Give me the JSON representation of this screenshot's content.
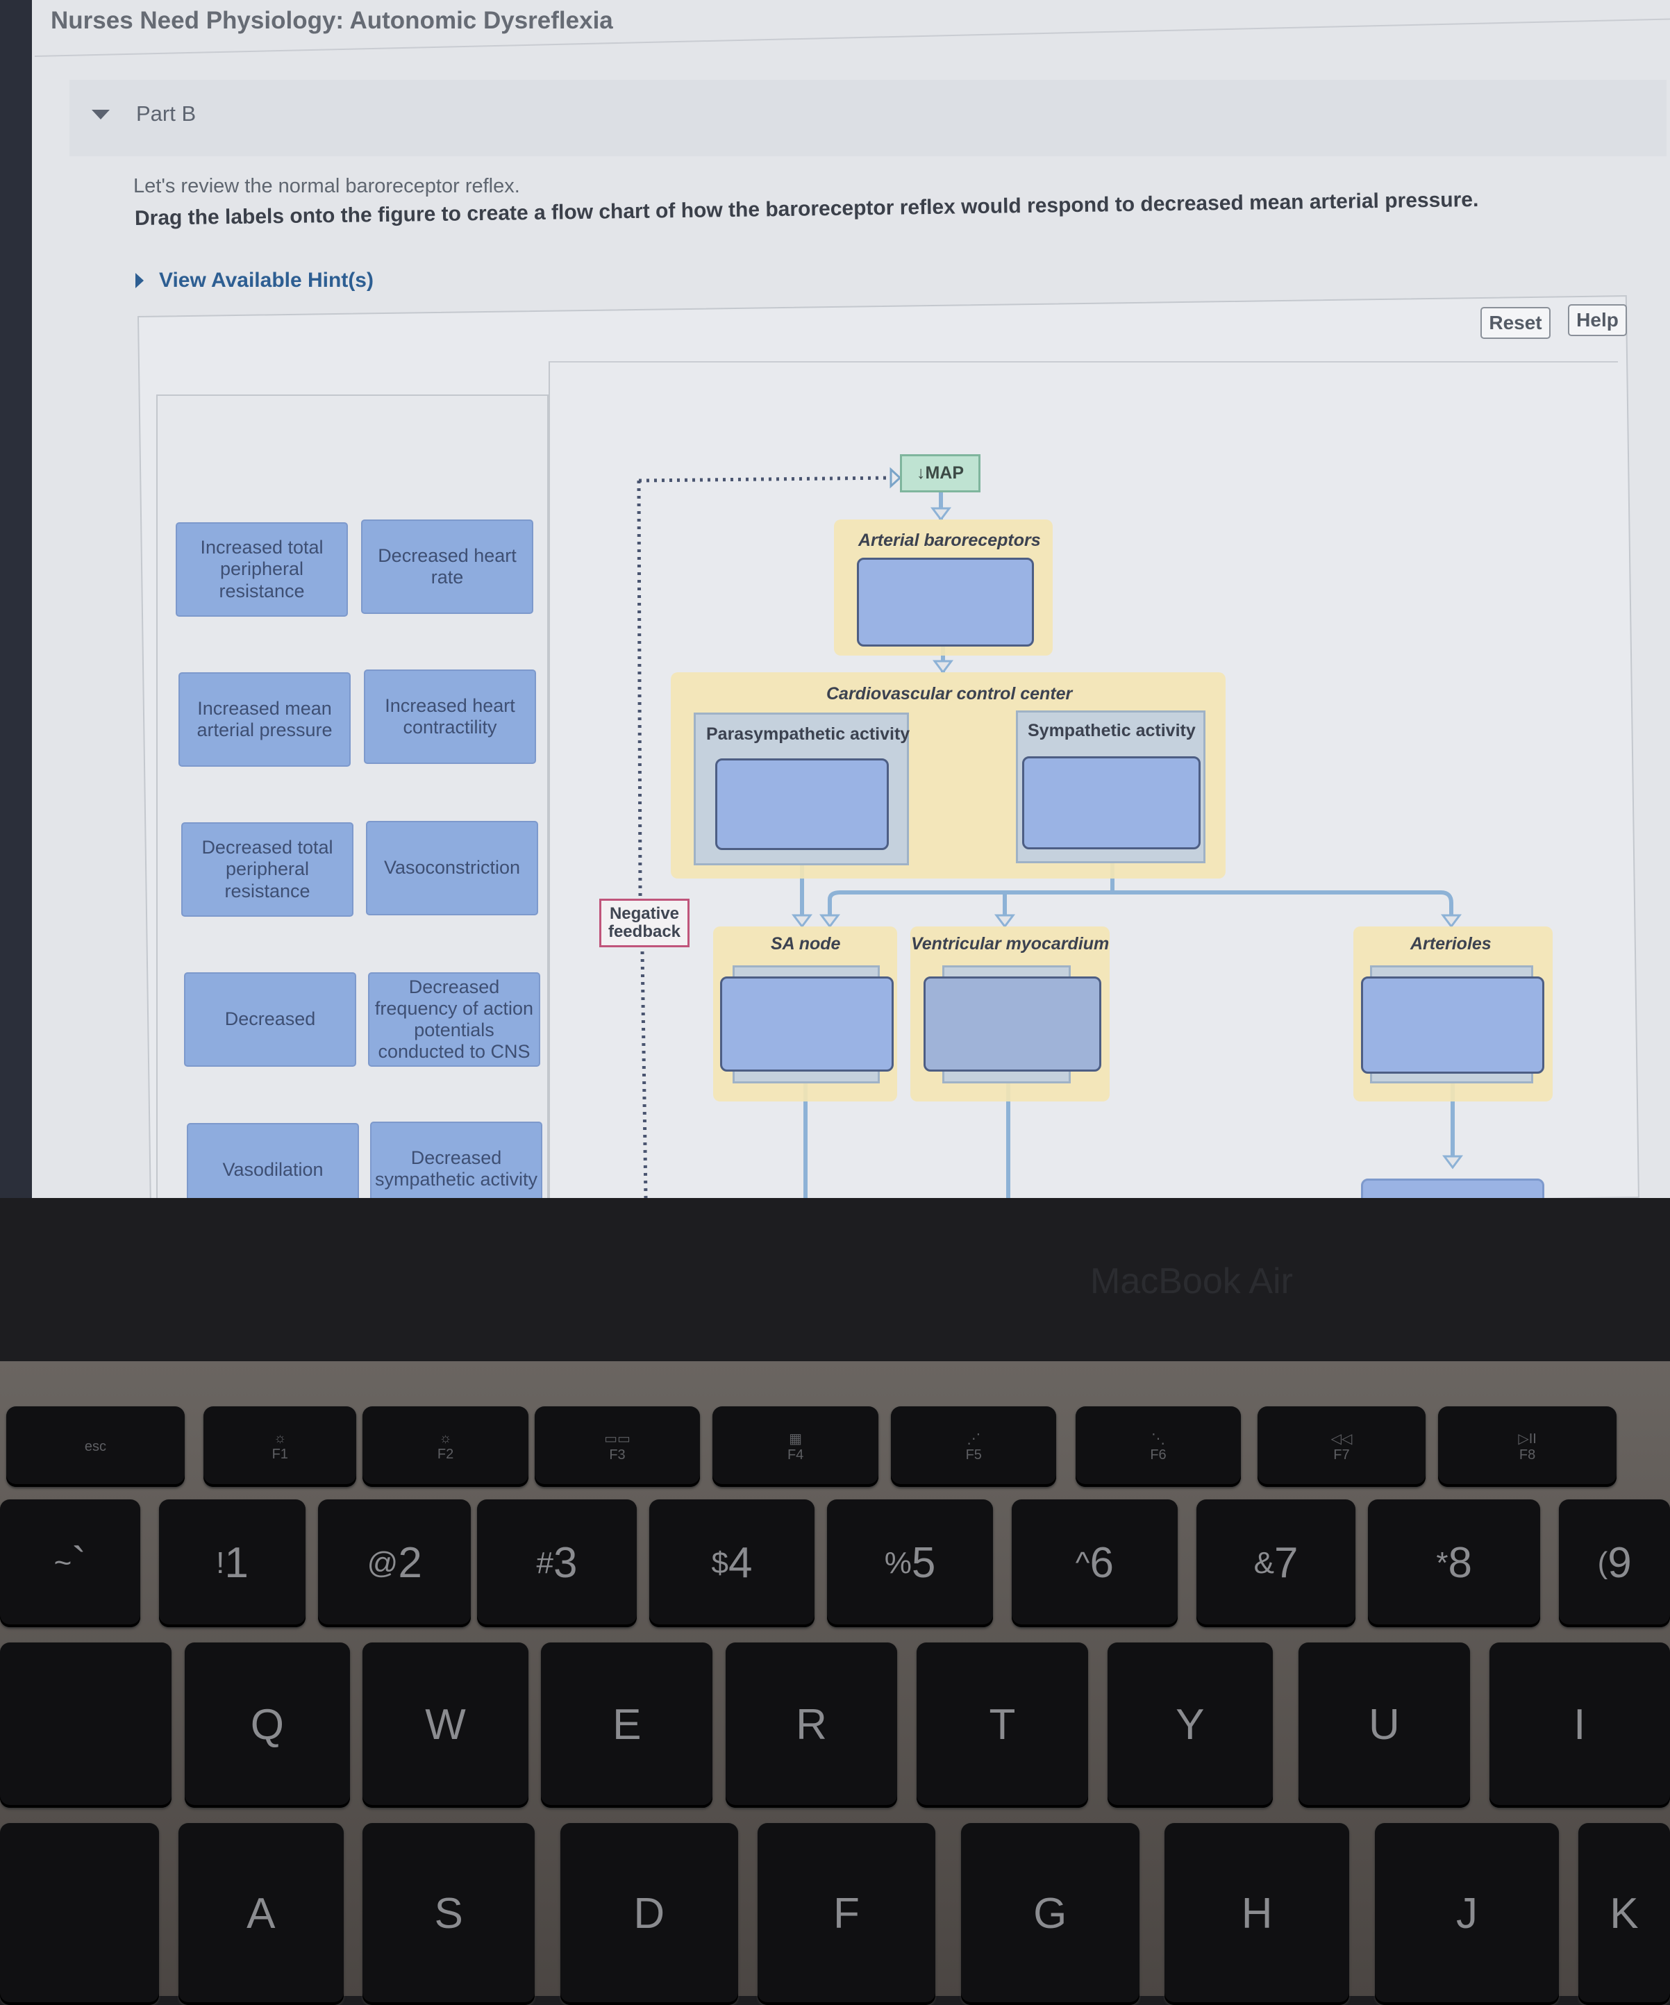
{
  "page": {
    "title": "Nurses Need Physiology: Autonomic Dysreflexia",
    "part": "Part B",
    "intro": "Let's review the normal baroreceptor reflex.",
    "instructions": "Drag the labels onto the figure to create a flow chart of how the baroreceptor reflex would respond to decreased mean arterial pressure.",
    "hint_link": "View Available Hint(s)"
  },
  "toolbar": {
    "reset": "Reset",
    "help": "Help"
  },
  "labels": [
    "Increased total peripheral resistance",
    "Decreased heart rate",
    "Increased mean arterial pressure",
    "Increased heart contractility",
    "Decreased total peripheral resistance",
    "Vasoconstriction",
    "Decreased",
    "Decreased frequency of action potentials conducted to CNS",
    "Vasodilation",
    "Decreased sympathetic activity"
  ],
  "diagram": {
    "map": "↓MAP",
    "arterial_baroreceptors": "Arterial baroreceptors",
    "control_center": "Cardiovascular control center",
    "parasympathetic": "Parasympathetic activity",
    "sympathetic": "Sympathetic activity",
    "sa_node": "SA node",
    "ventricular": "Ventricular myocardium",
    "arterioles": "Arterioles",
    "negative_feedback": "Negative feedback"
  },
  "device": {
    "brand": "MacBook Air"
  },
  "keyboard": {
    "fn_row": [
      [
        "",
        "esc"
      ],
      [
        "☼",
        "F1"
      ],
      [
        "☼",
        "F2"
      ],
      [
        "▭▭",
        "F3"
      ],
      [
        "▦",
        "F4"
      ],
      [
        "⋰",
        "F5"
      ],
      [
        "⋱",
        "F6"
      ],
      [
        "◁◁",
        "F7"
      ],
      [
        "▷II",
        "F8"
      ]
    ],
    "number_row": [
      [
        "~",
        "`"
      ],
      [
        "!",
        "1"
      ],
      [
        "@",
        "2"
      ],
      [
        "#",
        "3"
      ],
      [
        "$",
        "4"
      ],
      [
        "%",
        "5"
      ],
      [
        "^",
        "6"
      ],
      [
        "&",
        "7"
      ],
      [
        "*",
        "8"
      ],
      [
        "(",
        "9"
      ]
    ],
    "qwerty_row": [
      "",
      "Q",
      "W",
      "E",
      "R",
      "T",
      "Y",
      "U",
      "I"
    ],
    "home_row": [
      "",
      "A",
      "S",
      "D",
      "F",
      "G",
      "H",
      "J",
      "K"
    ]
  }
}
